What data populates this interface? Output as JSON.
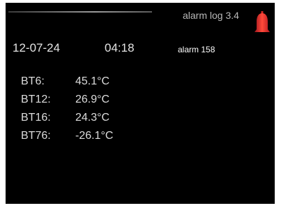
{
  "header": {
    "title": "alarm log 3.4",
    "icon": "alarm-bell-icon",
    "icon_color": "#e8302a"
  },
  "log": {
    "date": "12-07-24",
    "time": "04:18",
    "alarm": "alarm 158"
  },
  "readings": [
    {
      "label": "BT6:",
      "value": "45.1°C"
    },
    {
      "label": "BT12:",
      "value": "26.9°C"
    },
    {
      "label": "BT16:",
      "value": "24.3°C"
    },
    {
      "label": "BT76:",
      "value": "-26.1°C"
    }
  ]
}
